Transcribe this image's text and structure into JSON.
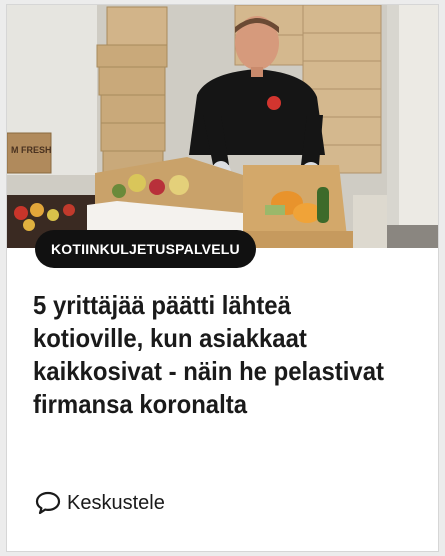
{
  "article": {
    "category": "KOTIINKULJETUSPALVELU",
    "headline_lines": [
      "5 yrittäjää päätti lähteä",
      "kotioville, kun asiakkaat",
      "kaikkosivat - näin he pelastivat",
      "firmansa koronalta"
    ],
    "comments_label": "Keskustele",
    "comments_icon": "speech-bubble-icon",
    "image_label": "M FRESH"
  },
  "colors": {
    "category_bg": "#111111",
    "category_text": "#ffffff",
    "headline_text": "#1a1a1a",
    "card_bg": "#ffffff",
    "page_bg": "#ececec"
  }
}
